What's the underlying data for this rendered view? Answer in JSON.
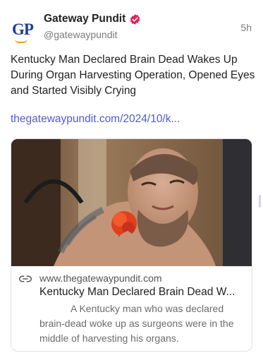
{
  "author": {
    "avatar_text": "GP",
    "name": "Gateway Pundit",
    "handle": "@gatewaypundit",
    "verified_icon": "verified-badge-icon",
    "verified_color": "#e0245e"
  },
  "post": {
    "time": "5h",
    "text": "Kentucky Man Declared Brain Dead Wakes Up During Organ Harvesting Operation, Opened Eyes and Started Visibly Crying",
    "link": "thegatewaypundit.com/2024/10/k..."
  },
  "card": {
    "link_icon": "link-icon",
    "domain": "www.thegatewaypundit.com",
    "title": "Kentucky Man Declared Brain Dead W...",
    "description": "A Kentucky man who was declared brain-dead woke up as surgeons were in the middle of harvesting his organs."
  },
  "colors": {
    "link": "#4f5bd5",
    "brand_blue": "#1d3f8f",
    "brand_orange": "#e6a020"
  }
}
